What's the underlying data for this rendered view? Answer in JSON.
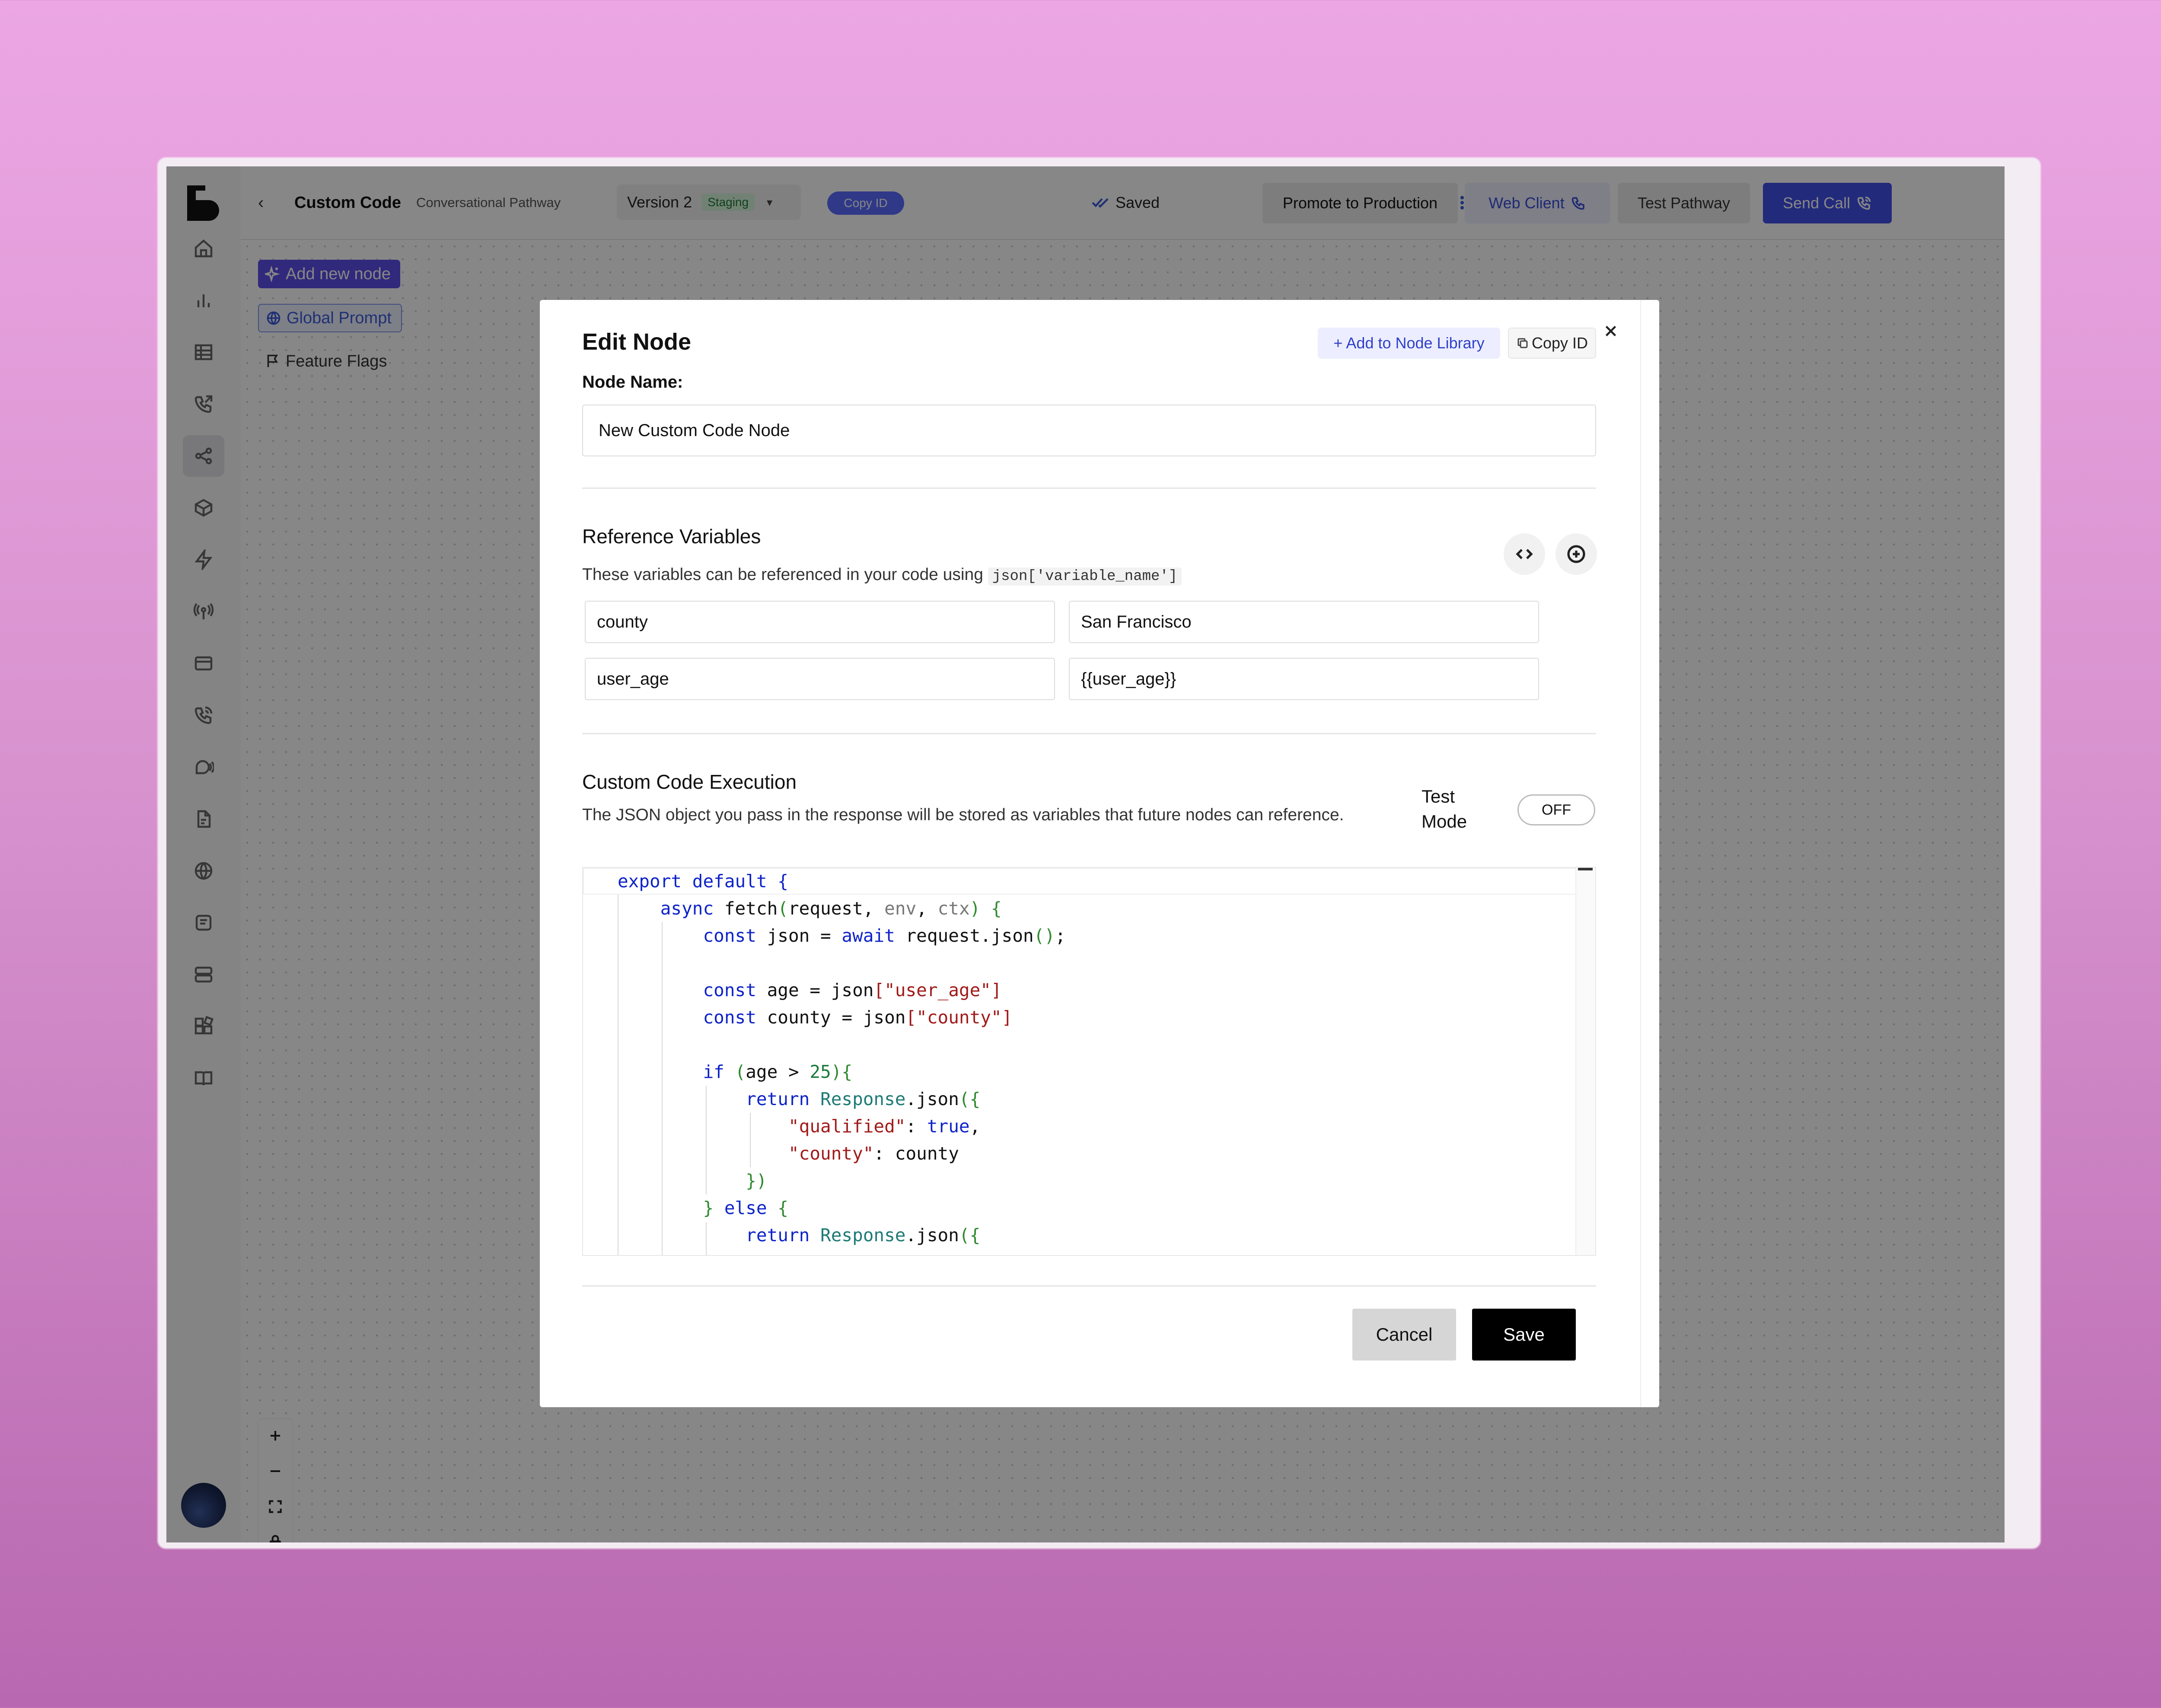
{
  "header": {
    "title": "Custom Code",
    "subtitle": "Conversational Pathway",
    "version_label": "Version 2",
    "version_badge": "Staging",
    "copy_id_label": "Copy ID",
    "saved_label": "Saved",
    "promote_label": "Promote to Production",
    "web_client_label": "Web Client",
    "test_pathway_label": "Test Pathway",
    "send_call_label": "Send Call"
  },
  "sidebar": {
    "items": [
      "home-icon",
      "analytics-icon",
      "table-icon",
      "phone-outgoing-icon",
      "pathway-icon",
      "box-icon",
      "lightning-icon",
      "radio-tower-icon",
      "card-icon",
      "phone-call-icon",
      "voice-icon",
      "document-icon",
      "globe-icon",
      "notes-icon",
      "server-icon",
      "apps-icon",
      "book-icon"
    ],
    "active_item": "pathway-icon"
  },
  "canvas": {
    "add_node_label": "Add new node",
    "global_prompt_label": "Global Prompt",
    "feature_flags_label": "Feature Flags"
  },
  "modal": {
    "title": "Edit Node",
    "add_library_label": "+ Add to Node Library",
    "copy_id_label": "Copy ID",
    "node_name_label": "Node Name:",
    "node_name_value": "New Custom Code Node",
    "ref_vars_title": "Reference Variables",
    "ref_vars_desc": "These variables can be referenced in your code using",
    "ref_vars_code": "json['variable_name']",
    "variables": [
      {
        "key": "county",
        "value": "San Francisco"
      },
      {
        "key": "user_age",
        "value": "{{user_age}}"
      }
    ],
    "code_exec_title": "Custom Code Execution",
    "code_exec_desc": "The JSON object you pass in the response will be stored as variables that future nodes can reference.",
    "test_mode_label": "Test Mode",
    "test_mode_state": "OFF",
    "cancel_label": "Cancel",
    "save_label": "Save"
  },
  "colors": {
    "accent": "#4150e8",
    "add_node_bg": "#5d4fe8",
    "staging_green": "#1f7a3a",
    "save_button": "#000000"
  }
}
